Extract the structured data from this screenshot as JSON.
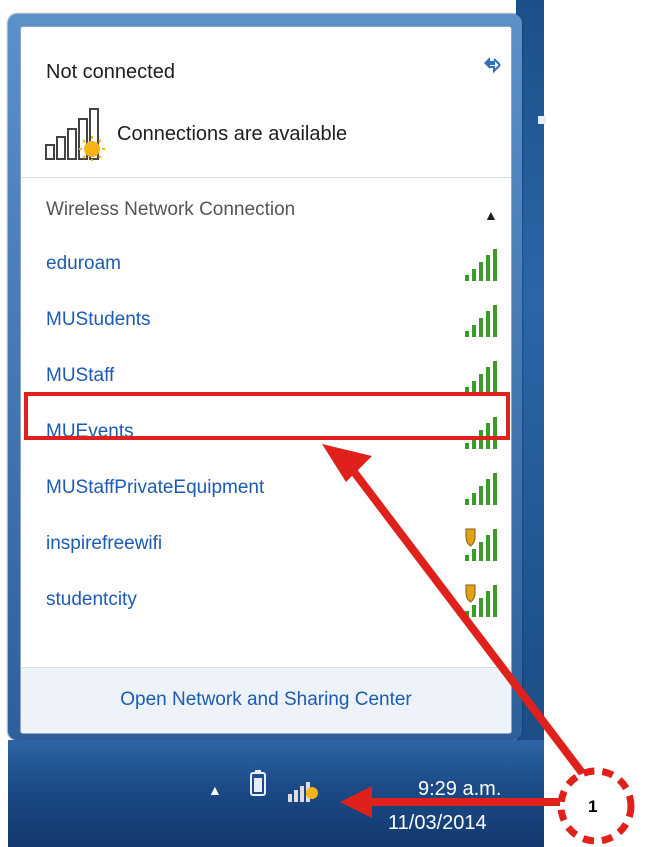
{
  "status": {
    "title": "Not connected",
    "subtitle": "Connections are available"
  },
  "section": {
    "title": "Wireless Network Connection"
  },
  "networks": [
    {
      "name": "eduroam",
      "secured": true
    },
    {
      "name": "MUStudents",
      "secured": true
    },
    {
      "name": "MUStaff",
      "secured": true
    },
    {
      "name": "MUEvents",
      "secured": true,
      "highlighted": true
    },
    {
      "name": "MUStaffPrivateEquipment",
      "secured": true
    },
    {
      "name": "inspirefreewifi",
      "secured": false
    },
    {
      "name": "studentcity",
      "secured": false
    }
  ],
  "footer": {
    "link": "Open Network and Sharing Center"
  },
  "taskbar": {
    "time": "9:29 a.m.",
    "date": "11/03/2014"
  },
  "annotation": {
    "step_number": "1",
    "color": "#e0201b"
  },
  "icons": {
    "refresh": "refresh-icon",
    "collapse": "chevron-up-icon",
    "signal": "wifi-signal-icon",
    "warning": "shield-warning-icon"
  }
}
